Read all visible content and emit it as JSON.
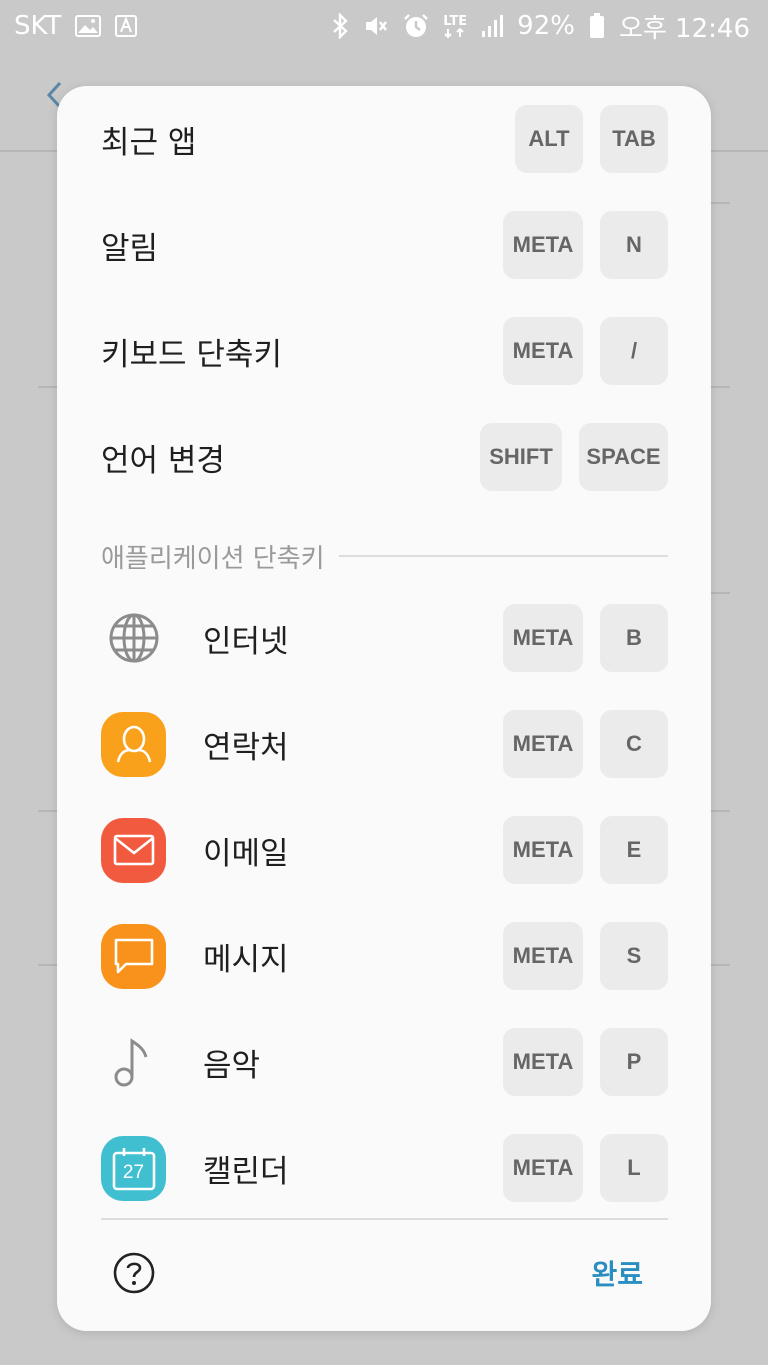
{
  "status_bar": {
    "carrier": "SKT",
    "network": "LTE",
    "battery": "92%",
    "time": "오후 12:46",
    "icons": [
      "image-icon",
      "a-badge-icon",
      "bluetooth-icon",
      "mute-icon",
      "alarm-icon",
      "lte-icon",
      "signal-icon",
      "battery-icon"
    ]
  },
  "dialog": {
    "system_shortcuts": [
      {
        "label": "최근 앱",
        "keys": [
          "ALT",
          "TAB"
        ]
      },
      {
        "label": "알림",
        "keys": [
          "META",
          "N"
        ]
      },
      {
        "label": "키보드 단축키",
        "keys": [
          "META",
          "/"
        ]
      },
      {
        "label": "언어 변경",
        "keys": [
          "SHIFT",
          "SPACE"
        ]
      }
    ],
    "app_section_title": "애플리케이션 단축키",
    "app_shortcuts": [
      {
        "label": "인터넷",
        "icon": "globe-icon",
        "keys": [
          "META",
          "B"
        ]
      },
      {
        "label": "연락처",
        "icon": "contacts-icon",
        "icon_color": "#f9a11b",
        "keys": [
          "META",
          "C"
        ]
      },
      {
        "label": "이메일",
        "icon": "email-icon",
        "icon_color": "#f25a3f",
        "keys": [
          "META",
          "E"
        ]
      },
      {
        "label": "메시지",
        "icon": "message-icon",
        "icon_color": "#f8921a",
        "keys": [
          "META",
          "S"
        ]
      },
      {
        "label": "음악",
        "icon": "music-note-icon",
        "keys": [
          "META",
          "P"
        ]
      },
      {
        "label": "캘린더",
        "icon": "calendar-icon",
        "icon_color": "#3fbfd0",
        "calendar_day": "27",
        "keys": [
          "META",
          "L"
        ]
      }
    ],
    "done_label": "완료"
  },
  "colors": {
    "accent": "#2a8fc0",
    "dialog_bg": "#fafafa",
    "key_bg": "#ebebeb"
  }
}
